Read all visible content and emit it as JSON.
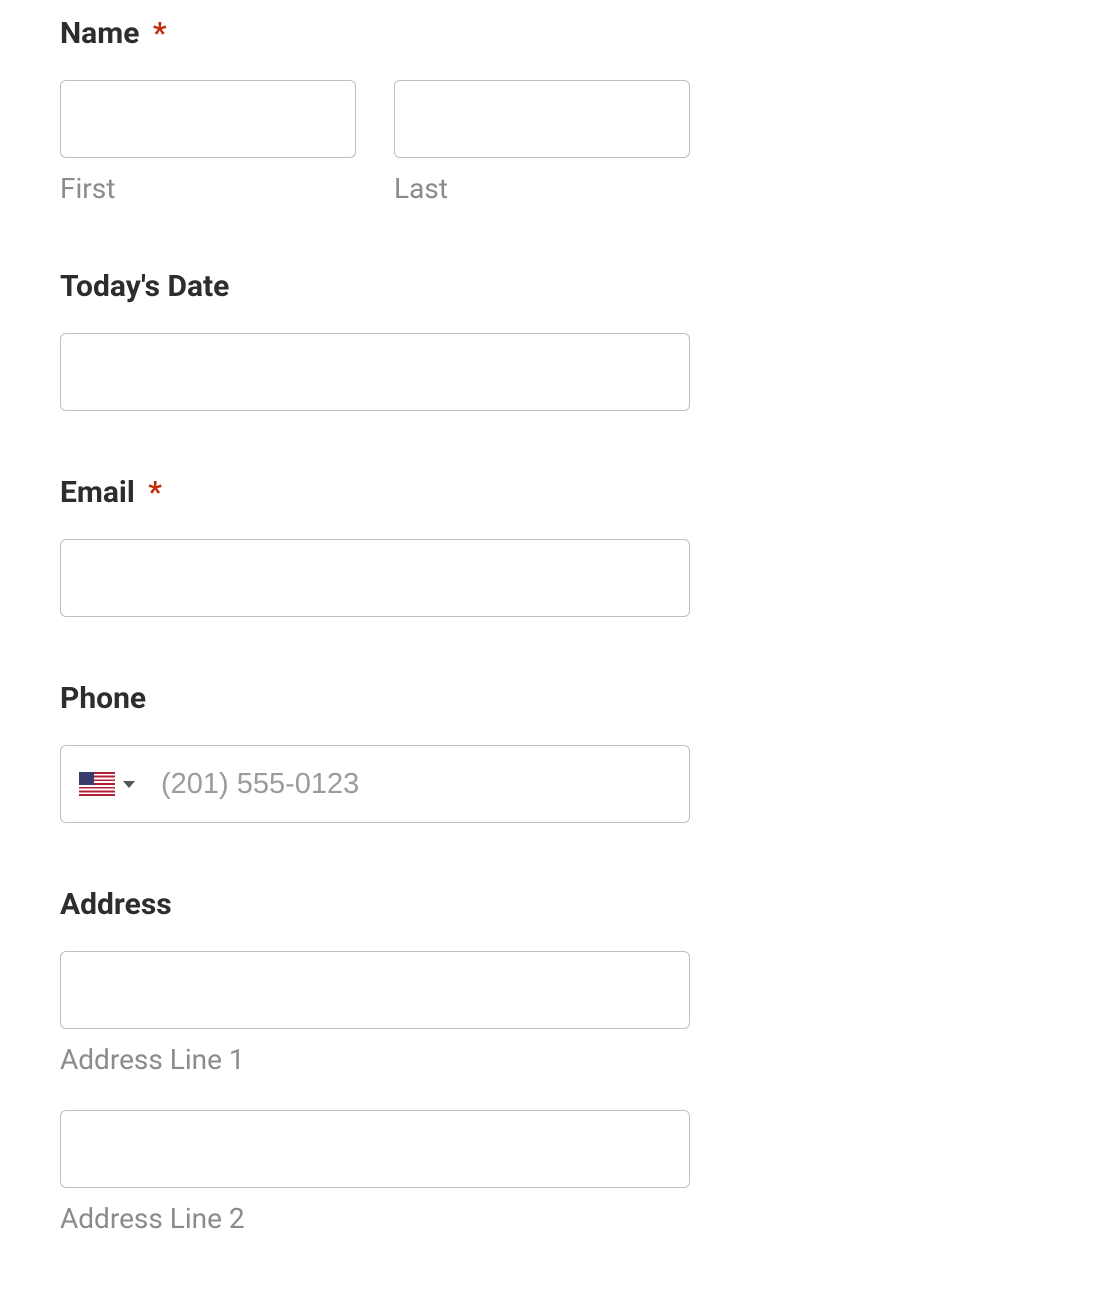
{
  "name": {
    "label": "Name",
    "required": "*",
    "first_sublabel": "First",
    "last_sublabel": "Last",
    "first_value": "",
    "last_value": ""
  },
  "date": {
    "label": "Today's Date",
    "value": ""
  },
  "email": {
    "label": "Email",
    "required": "*",
    "value": ""
  },
  "phone": {
    "label": "Phone",
    "placeholder": "(201) 555-0123",
    "value": "",
    "country": "US"
  },
  "address": {
    "label": "Address",
    "line1_sublabel": "Address Line 1",
    "line2_sublabel": "Address Line 2",
    "line1_value": "",
    "line2_value": ""
  }
}
